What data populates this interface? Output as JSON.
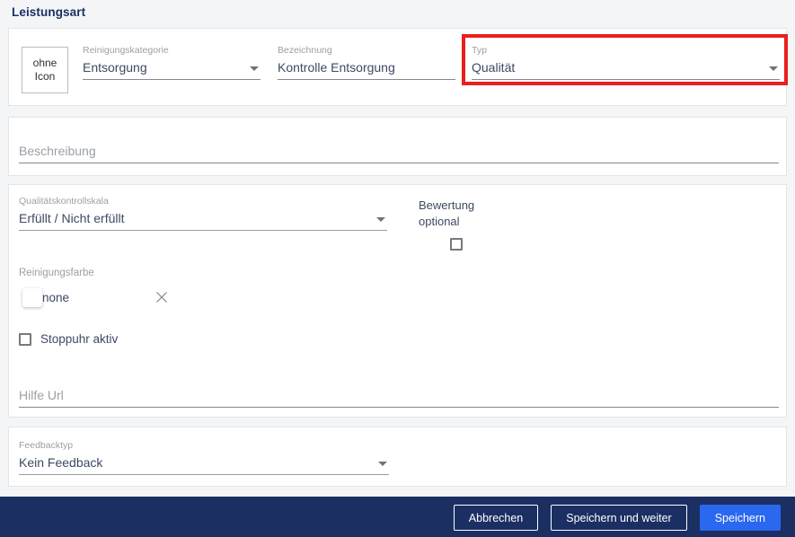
{
  "header": {
    "title": "Leistungsart"
  },
  "colors": {
    "page_background": "#f4f5f7",
    "card_background": "#ffffff",
    "title": "#1b2f63",
    "label": "#9aa0a6",
    "value": "#3c4a63",
    "highlight": "#e8201f",
    "footer": "#1b2f63",
    "primary_button": "#2b68f0"
  },
  "identity_card": {
    "icon_placeholder": {
      "line1": "ohne",
      "line2": "Icon"
    },
    "category": {
      "label": "Reinigungskategorie",
      "value": "Entsorgung",
      "caret": "chevron-down-icon"
    },
    "designation": {
      "label": "Bezeichnung",
      "value": "Kontrolle Entsorgung"
    },
    "type": {
      "label": "Typ",
      "value": "Qualität",
      "caret": "chevron-down-icon",
      "highlighted": true
    }
  },
  "description_card": {
    "description": {
      "label": "Beschreibung",
      "value": "",
      "placeholder": "Beschreibung"
    }
  },
  "quality_card": {
    "scale": {
      "label": "Qualitätskontrollskala",
      "value": "Erfüllt / Nicht erfüllt",
      "caret": "chevron-down-icon"
    },
    "evaluation": {
      "line1": "Bewertung",
      "line2": "optional",
      "checked": false
    },
    "cleaning_color": {
      "label": "Reinigungsfarbe",
      "swatch_name": "none",
      "swatch_color": "#ffffff",
      "clear_icon": "close-icon"
    },
    "stopwatch": {
      "label": "Stoppuhr aktiv",
      "checked": false
    },
    "help_url": {
      "label": "Hilfe Url",
      "value": "",
      "placeholder": "Hilfe Url"
    }
  },
  "feedback_card": {
    "feedback_type": {
      "label": "Feedbacktyp",
      "value": "Kein Feedback",
      "caret": "chevron-down-icon"
    }
  },
  "footer": {
    "cancel_label": "Abbrechen",
    "save_continue_label": "Speichern und weiter",
    "save_label": "Speichern"
  }
}
